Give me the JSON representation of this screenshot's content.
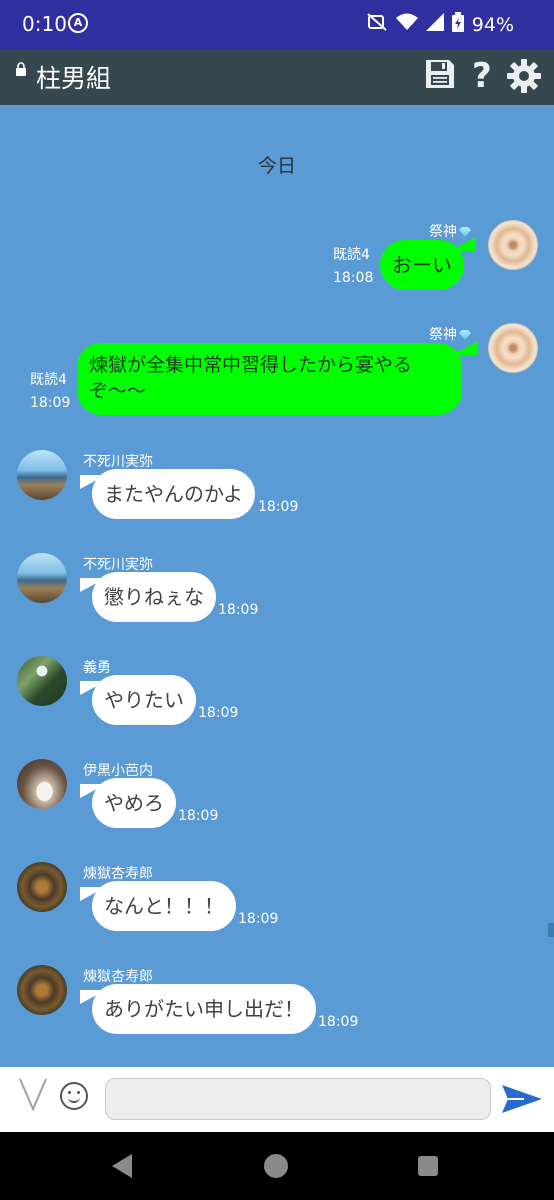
{
  "status_bar": {
    "time": "0:10",
    "accessibility_badge": "A",
    "battery": "94%",
    "icons": [
      "mute-icon",
      "wifi-icon",
      "signal-icon",
      "battery-icon"
    ]
  },
  "header": {
    "title": "柱男組",
    "icons": [
      "lock-icon",
      "save-icon",
      "help-icon",
      "settings-icon"
    ],
    "background": "#37474f"
  },
  "chat": {
    "background": "#5b9bd5",
    "date_label": "今日",
    "messages": [
      {
        "side": "right",
        "sender": "祭神",
        "badge": "gem-icon",
        "text": "おーい",
        "read": "既読4",
        "time": "18:08",
        "bubble_color": "#00ff00"
      },
      {
        "side": "right",
        "sender": "祭神",
        "badge": "gem-icon",
        "text_line1": "煉獄が全集中常中習得したから宴やる",
        "text_line2": "ぞ〜〜",
        "read": "既読4",
        "time": "18:09",
        "bubble_color": "#00ff00"
      },
      {
        "side": "left",
        "sender": "不死川実弥",
        "text": "またやんのかよ",
        "time": "18:09"
      },
      {
        "side": "left",
        "sender": "不死川実弥",
        "text": "懲りねぇな",
        "time": "18:09"
      },
      {
        "side": "left",
        "sender": "義勇",
        "text": "やりたい",
        "time": "18:09"
      },
      {
        "side": "left",
        "sender": "伊黒小芭内",
        "text": "やめろ",
        "time": "18:09"
      },
      {
        "side": "left",
        "sender": "煉獄杏寿郎",
        "text": "なんと！！！",
        "time": "18:09"
      },
      {
        "side": "left",
        "sender": "煉獄杏寿郎",
        "text": "ありがたい申し出だ！",
        "time": "18:09"
      }
    ]
  },
  "input_bar": {
    "placeholder": "",
    "value": "",
    "icons": [
      "expand-icon",
      "emoji-icon",
      "send-icon"
    ],
    "send_color": "#2a6ad0"
  },
  "nav_bar": {
    "icons": [
      "back-icon",
      "home-icon",
      "recents-icon"
    ]
  }
}
